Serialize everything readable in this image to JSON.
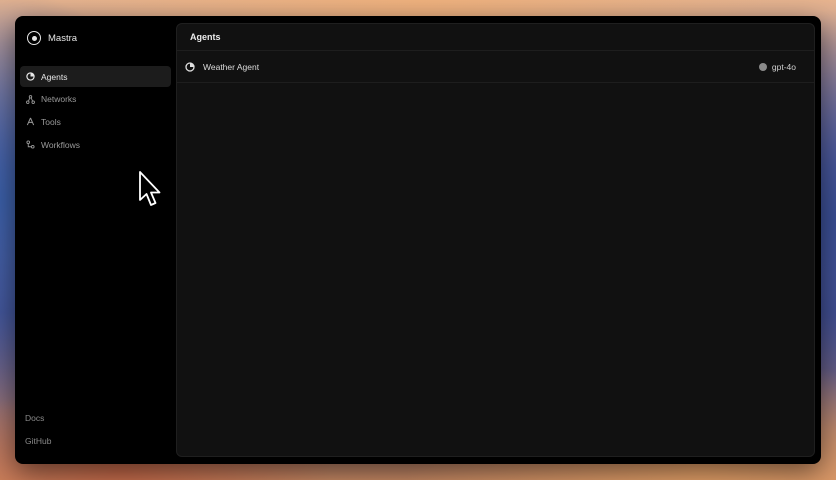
{
  "app": {
    "name": "Mastra"
  },
  "sidebar": {
    "items": [
      {
        "label": "Agents",
        "icon": "agent-icon",
        "active": true
      },
      {
        "label": "Networks",
        "icon": "network-icon",
        "active": false
      },
      {
        "label": "Tools",
        "icon": "tools-icon",
        "active": false
      },
      {
        "label": "Workflows",
        "icon": "workflow-icon",
        "active": false
      }
    ],
    "footer": [
      {
        "label": "Docs"
      },
      {
        "label": "GitHub"
      }
    ]
  },
  "main": {
    "title": "Agents",
    "agents": [
      {
        "name": "Weather Agent",
        "model": "gpt-4o",
        "model_icon": "openai-icon"
      }
    ]
  }
}
